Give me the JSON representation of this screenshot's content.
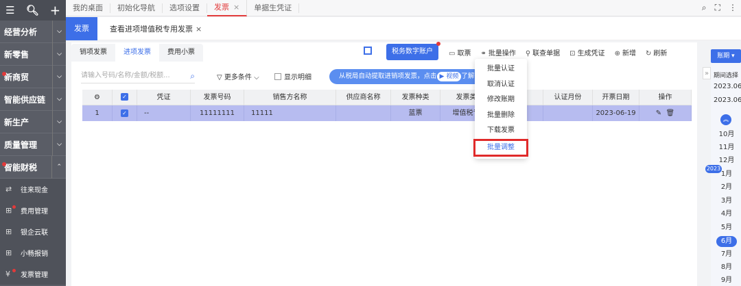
{
  "sidebar": {
    "top_icons": [
      "menu-icon",
      "search-icon",
      "plus-icon"
    ],
    "menus": [
      {
        "label": "经营分析",
        "dot": false
      },
      {
        "label": "新零售",
        "dot": false
      },
      {
        "label": "新商贸",
        "dot": true
      },
      {
        "label": "智能供应链",
        "dot": false
      },
      {
        "label": "新生产",
        "dot": false
      },
      {
        "label": "质量管理",
        "dot": false
      },
      {
        "label": "智能财税",
        "dot": true
      }
    ],
    "subitems": [
      {
        "label": "往来现金",
        "dot": false
      },
      {
        "label": "费用管理",
        "dot": true
      },
      {
        "label": "银企云联",
        "dot": false
      },
      {
        "label": "小畅报销",
        "dot": false
      },
      {
        "label": "发票管理",
        "dot": true
      }
    ]
  },
  "topbar": {
    "tabs": [
      "我的桌面",
      "初始化导航",
      "选项设置",
      "发票",
      "单据生凭证"
    ],
    "close_mark": "×"
  },
  "subheader": {
    "tab": "发票",
    "title": "查看进项增值税专用发票",
    "close_mark": "×"
  },
  "invoice_tabs": [
    "销项发票",
    "进项发票",
    "费用小票"
  ],
  "tax_button": "税务数字账户",
  "toolbar": [
    "取票",
    "批量操作",
    "联查单据",
    "生成凭证",
    "新增",
    "刷新"
  ],
  "search": {
    "placeholder": "请输入号码/名称/金额/税额..."
  },
  "filter_label": "更多条件",
  "detail_label": "显示明细",
  "banner": {
    "text": "从税局自动提取进销项发票，点击",
    "video": "视频",
    "tail": "了解一"
  },
  "table": {
    "headers": [
      "凭证",
      "发票号码",
      "销售方名称",
      "供应商名称",
      "发票种类",
      "发票类型",
      "",
      "认证月份",
      "开票日期",
      "操作"
    ],
    "rows": [
      {
        "index": "1",
        "voucher": "--",
        "number": "11111111",
        "seller": "11111",
        "supplier": "",
        "kind": "蓝票",
        "type": "增值税专用",
        "blank": "",
        "month": "",
        "date": "2023-06-19"
      }
    ]
  },
  "dropdown": [
    "批量认证",
    "取消认证",
    "修改账期",
    "批量删除",
    "下载发票",
    "批量调整"
  ],
  "period": {
    "button": "账期",
    "label": "期间选择",
    "from": "2023.06",
    "to": "2023.06",
    "months_before": [
      "10月",
      "11月",
      "12月"
    ],
    "year": "2023",
    "months_after": [
      "1月",
      "2月",
      "3月",
      "4月",
      "5月",
      "6月",
      "7月",
      "8月",
      "9月"
    ],
    "selected": "6月"
  },
  "colors": {
    "accent": "#3d6fe8",
    "highlight": "#e02a2a",
    "row_selected": "#b7bcf0",
    "sidebar": "#5a5d66"
  }
}
